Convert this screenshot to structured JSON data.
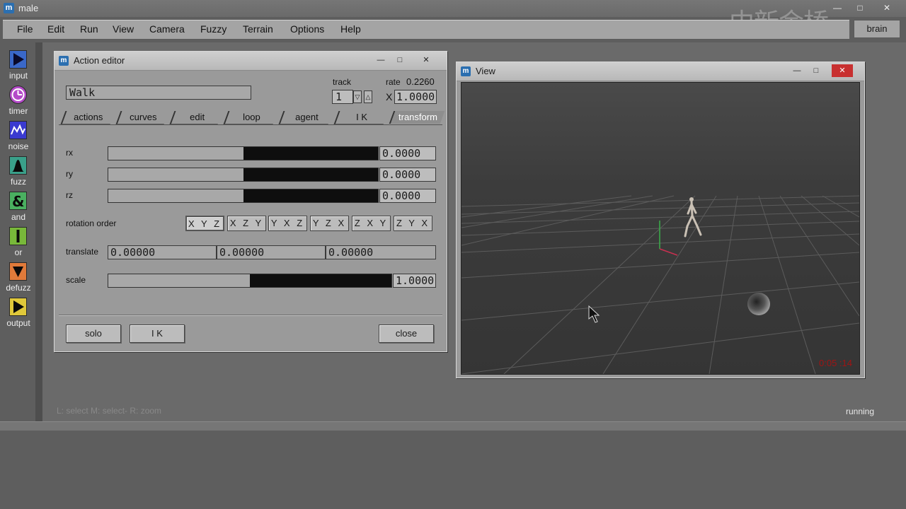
{
  "app": {
    "title": "male",
    "logo": "m",
    "watermark": "中新金桥"
  },
  "menu": [
    "File",
    "Edit",
    "Run",
    "View",
    "Camera",
    "Fuzzy",
    "Terrain",
    "Options",
    "Help"
  ],
  "brain_button": "brain",
  "tools": [
    {
      "label": "input",
      "icon": "input-arrow-icon"
    },
    {
      "label": "timer",
      "icon": "timer-clock-icon"
    },
    {
      "label": "noise",
      "icon": "noise-wave-icon"
    },
    {
      "label": "fuzz",
      "icon": "fuzz-bell-icon"
    },
    {
      "label": "and",
      "icon": "and-ampersand-icon"
    },
    {
      "label": "or",
      "icon": "or-bar-icon"
    },
    {
      "label": "defuzz",
      "icon": "defuzz-triangle-icon"
    },
    {
      "label": "output",
      "icon": "output-arrow-icon"
    }
  ],
  "editor": {
    "title": "Action editor",
    "action_name": "Walk",
    "track_label": "track",
    "track_value": "1",
    "rate_label": "rate",
    "rate_value": "0.2260",
    "x_label": "X",
    "x_value": "1.0000",
    "tabs": [
      "actions",
      "curves",
      "edit",
      "loop",
      "agent",
      "I K",
      "transform"
    ],
    "active_tab": "transform",
    "rx": {
      "label": "rx",
      "value": "0.0000",
      "level": 0.5
    },
    "ry": {
      "label": "ry",
      "value": "0.0000",
      "level": 0.5
    },
    "rz": {
      "label": "rz",
      "value": "0.0000",
      "level": 0.5
    },
    "rotation_order_label": "rotation order",
    "rotation_orders": [
      "X Y Z",
      "X Z Y",
      "Y X Z",
      "Y Z X",
      "Z X Y",
      "Z Y X"
    ],
    "rotation_order_selected": "X Y Z",
    "translate_label": "translate",
    "translate": [
      "0.00000",
      "0.00000",
      "0.00000"
    ],
    "scale": {
      "label": "scale",
      "value": "1.0000",
      "level": 0.5
    },
    "solo_button": "solo",
    "ik_button": "I K",
    "close_button": "close"
  },
  "view": {
    "title": "View",
    "timecode": "0:05 :14"
  },
  "status": {
    "hint": "L: select   M: select-   R: zoom",
    "state": "running"
  },
  "colors": {
    "timecode": "#a01414",
    "logo": "#2b6fb0"
  }
}
